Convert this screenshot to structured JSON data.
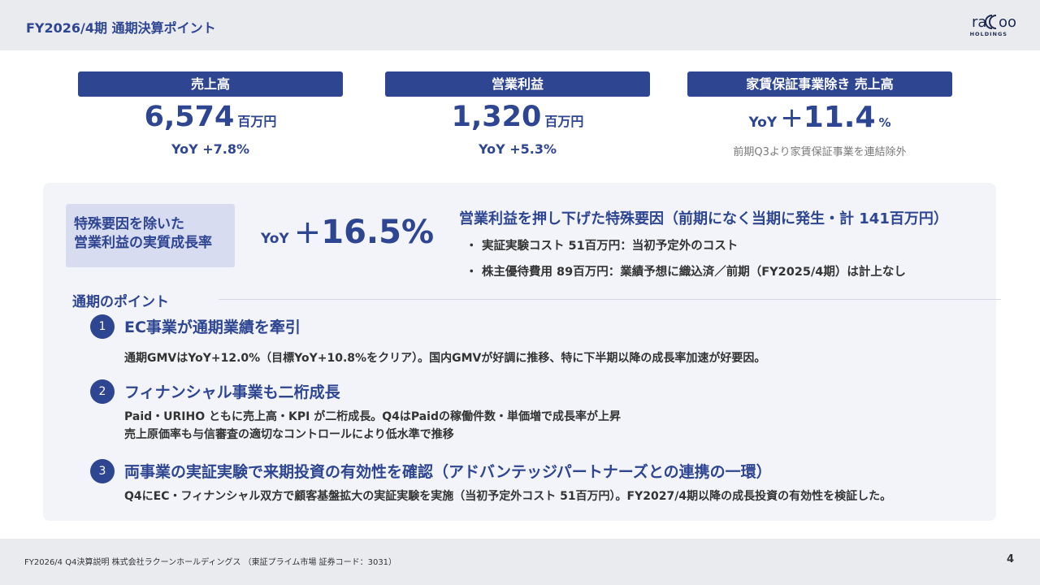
{
  "header": {
    "title": "FY2026/4期 通期決算ポイント",
    "logo_word": "ra(oon",
    "logo_sub": "HOLDINGS"
  },
  "kpis": [
    {
      "label": "売上高",
      "value": "6,574",
      "unit": "百万円",
      "yoy": "YoY +7.8%"
    },
    {
      "label": "営業利益",
      "value": "1,320",
      "unit": "百万円",
      "yoy": "YoY +5.3%"
    },
    {
      "label": "家賃保証事業除き 売上高",
      "yoy_label": "YoY",
      "plus": "+",
      "value": "11.4",
      "unit": "%",
      "note": "前期Q3より家賃保証事業を連結除外"
    }
  ],
  "special": {
    "box_line1": "特殊要因を除いた",
    "box_line2": "営業利益の実質成長率",
    "yoy_label": "YoY",
    "plus": "+",
    "value": "16.5%"
  },
  "factors": {
    "title": "営業利益を押し下げた特殊要因（前期になく当期に発生・計 141百万円）",
    "bullet": "・",
    "items": [
      "実証実験コスト 51百万円：当初予定外のコスト",
      "株主優待費用 89百万円：業績予想に織込済／前期（FY2025/4期）は計上なし"
    ]
  },
  "points": {
    "title": "通期のポイント",
    "items": [
      {
        "num": "1",
        "title": "EC事業が通期業績を牽引",
        "lines": [
          "通期GMVはYoY+12.0%（目標YoY+10.8%をクリア）。国内GMVが好調に推移、特に下半期以降の成長率加速が好要因。"
        ]
      },
      {
        "num": "2",
        "title": "フィナンシャル事業も二桁成長",
        "lines": [
          "Paid・URIHO ともに売上高・KPI が二桁成長。Q4はPaidの稼働件数・単価増で成長率が上昇",
          "売上原価率も与信審査の適切なコントロールにより低水準で推移"
        ]
      },
      {
        "num": "3",
        "title": "両事業の実証実験で来期投資の有効性を確認（アドバンテッジパートナーズとの連携の一環）",
        "lines": [
          "Q4にEC・フィナンシャル双方で顧客基盤拡大の実証実験を実施（当初予定外コスト 51百万円）。FY2027/4期以降の成長投資の有効性を検証した。"
        ]
      }
    ]
  },
  "footer": {
    "text": "FY2026/4 Q4決算説明 株式会社ラクーンホールディングス （東証プライム市場 証券コード：3031）",
    "page": "4"
  },
  "colors": {
    "brand": "#2e4592",
    "panel": "#f2f4f9",
    "header_bg": "#e9ebef"
  }
}
